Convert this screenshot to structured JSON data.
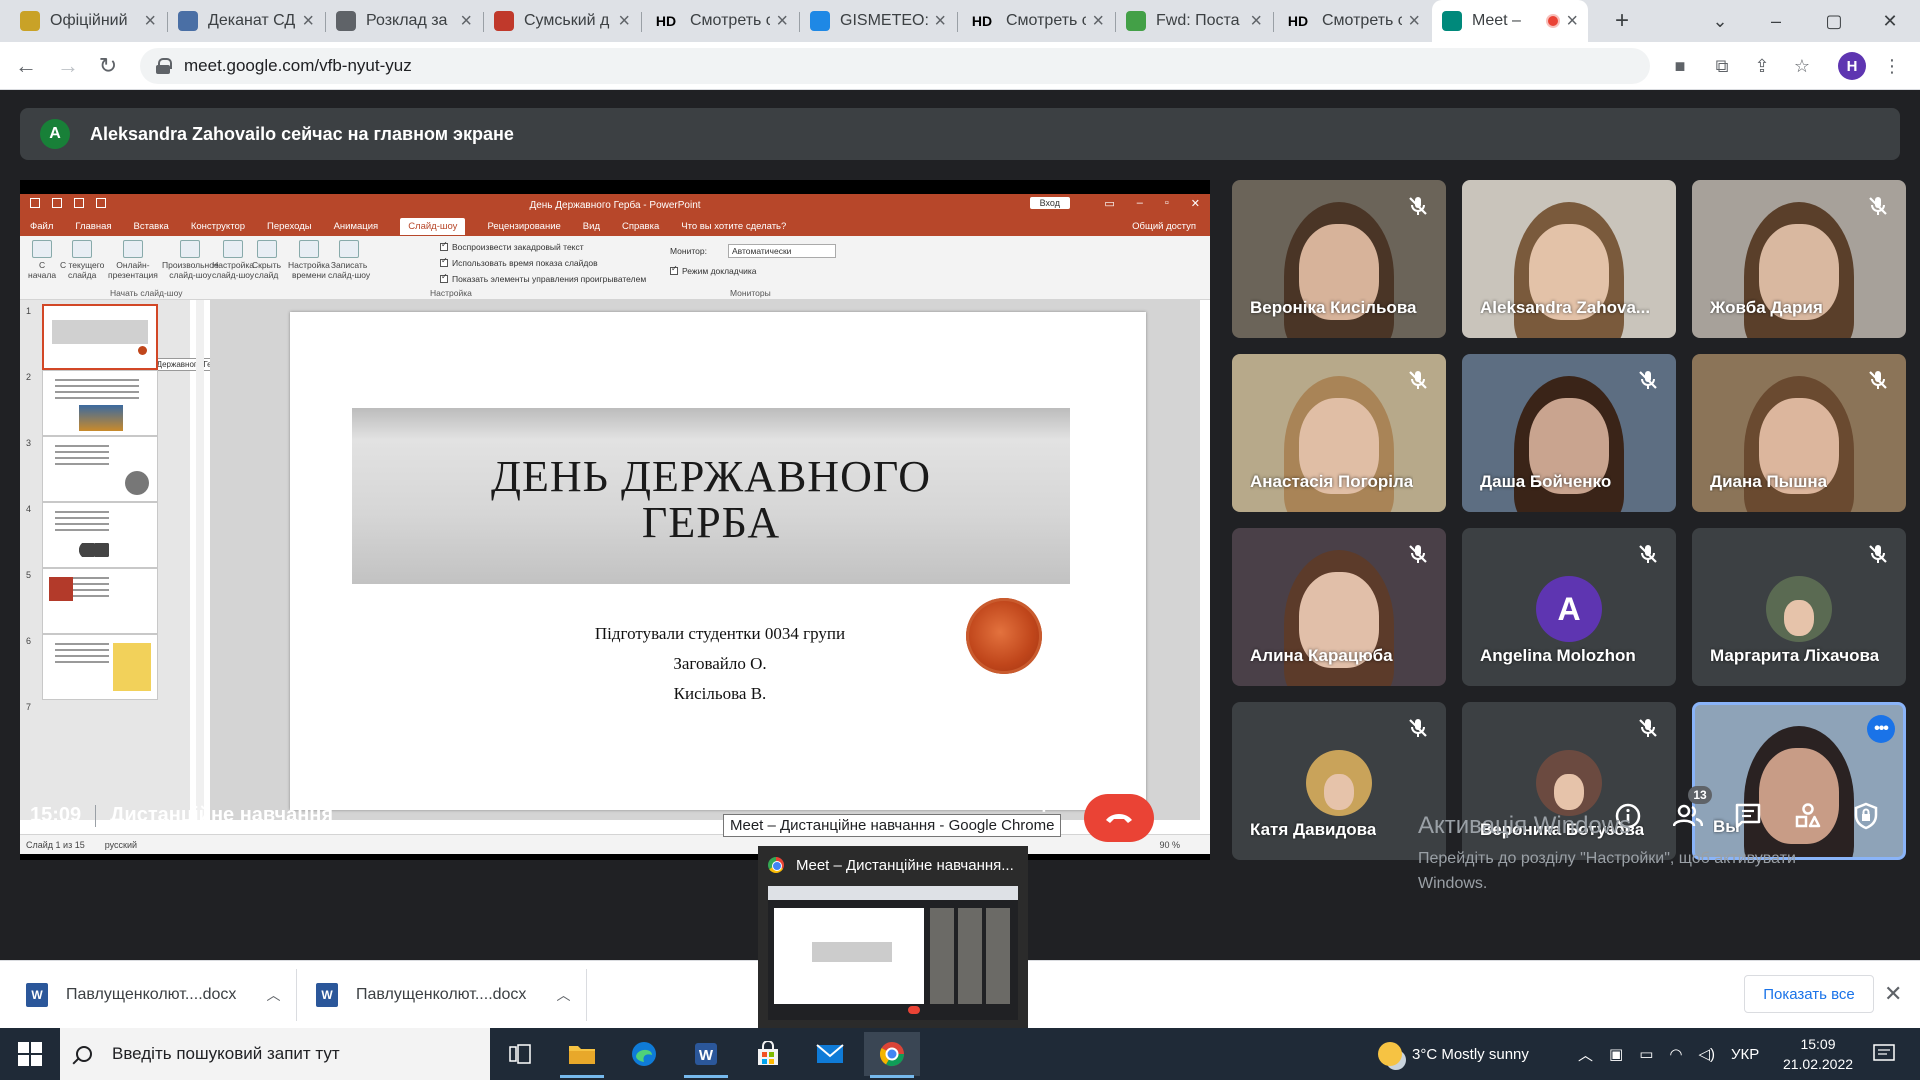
{
  "browser": {
    "tabs": [
      {
        "label": "Офіційний",
        "icon": "crest-icon",
        "color": "#c9a227"
      },
      {
        "label": "Деканат СД",
        "icon": "tool-icon",
        "color": "#4a6fa5"
      },
      {
        "label": "Розклад за",
        "icon": "globe-icon",
        "color": "#5f6368"
      },
      {
        "label": "Сумський д",
        "icon": "book-icon",
        "color": "#c0392b"
      },
      {
        "label": "Смотреть с",
        "icon": "hd-icon",
        "color": "#000000"
      },
      {
        "label": "GISMETEO:",
        "icon": "drop-icon",
        "color": "#1e88e5"
      },
      {
        "label": "Смотреть с",
        "icon": "hd-icon",
        "color": "#000000"
      },
      {
        "label": "Fwd: Поста",
        "icon": "mail-icon",
        "color": "#43a047"
      },
      {
        "label": "Смотреть с",
        "icon": "hd-icon",
        "color": "#000000"
      },
      {
        "label": "Meet –",
        "icon": "meet-icon",
        "color": "#00897b",
        "active": true
      }
    ],
    "hd_text": "HD",
    "url": "meet.google.com/vfb-nyut-yuz",
    "profile_initial": "H",
    "profile_color": "#5e35b1"
  },
  "meet": {
    "presenter_initial": "A",
    "presenting_text": "Aleksandra Zahovailo сейчас на главном экране",
    "time": "15:09",
    "meeting_name": "Дистанційне навчання",
    "participants_count": "13",
    "tooltip": "Meet – Дистанційне навчання - Google Chrome",
    "preview_title": "Meet – Дистанційне навчання...",
    "participants": [
      {
        "name": "Вероніка Кисільова",
        "type": "video",
        "bg": "#6b6459",
        "skin": "#d7b39a",
        "hair": "#4a3526",
        "muted": true
      },
      {
        "name": "Aleksandra Zahova...",
        "type": "video",
        "bg": "#c9c4bb",
        "skin": "#e3c2a8",
        "hair": "#7a5a3c",
        "muted": false
      },
      {
        "name": "Жовба Дария",
        "type": "video",
        "bg": "#a7a19a",
        "skin": "#d9b8a0",
        "hair": "#5a3f2a",
        "muted": true
      },
      {
        "name": "Анастасія Погоріла",
        "type": "video",
        "bg": "#b7a98a",
        "skin": "#e0bea5",
        "hair": "#a98457",
        "muted": true
      },
      {
        "name": "Даша Бойченко",
        "type": "video",
        "bg": "#5d6e82",
        "skin": "#c9a48f",
        "hair": "#3a2418",
        "muted": true
      },
      {
        "name": "Диана Пышна",
        "type": "video",
        "bg": "#8b7458",
        "skin": "#dcb69d",
        "hair": "#6a4a30",
        "muted": true
      },
      {
        "name": "Алина Карацюба",
        "type": "video",
        "bg": "#4a4048",
        "skin": "#e1bfa9",
        "hair": "#5c3b2a",
        "muted": true
      },
      {
        "name": "Angelina Molozhon",
        "type": "initial",
        "initial": "A",
        "color": "#5e35b1",
        "muted": true
      },
      {
        "name": "Маргарита Ліхачова",
        "type": "photo",
        "color": "#5a6a52",
        "muted": true
      },
      {
        "name": "Катя Давидова",
        "type": "photo",
        "color": "#c9a35a",
        "muted": true
      },
      {
        "name": "Вероника Ботузова",
        "type": "photo",
        "color": "#6b4a40",
        "muted": true
      },
      {
        "name": "Вы",
        "type": "video",
        "bg": "#8ea3b8",
        "skin": "#c89c86",
        "hair": "#2a2222",
        "muted": false,
        "self": true
      }
    ],
    "activation": {
      "title": "Активація Windows",
      "subtitle": "Перейдіть до розділу \"Настройки\", щоб активувати Windows."
    }
  },
  "ppt": {
    "window_title": "День Державного Герба - PowerPoint",
    "login": "Вход",
    "share": "Общий доступ",
    "menu": [
      "Файл",
      "Главная",
      "Вставка",
      "Конструктор",
      "Переходы",
      "Анимация",
      "Слайд-шоу",
      "Рецензирование",
      "Вид",
      "Справка",
      "Что вы хотите сделать?"
    ],
    "active_menu_index": 6,
    "ribbon_buttons": [
      {
        "l1": "С",
        "l2": "начала"
      },
      {
        "l1": "С текущего",
        "l2": "слайда"
      },
      {
        "l1": "Онлайн-",
        "l2": "презентация"
      },
      {
        "l1": "Произвольное",
        "l2": "слайд-шоу"
      },
      {
        "l1": "Настройка",
        "l2": "слайд-шоу"
      },
      {
        "l1": "Скрыть",
        "l2": "слайд"
      },
      {
        "l1": "Настройка",
        "l2": "времени"
      },
      {
        "l1": "Записать",
        "l2": "слайд-шоу"
      }
    ],
    "group_start": "Начать слайд-шоу",
    "group_setup": "Настройка",
    "group_monitors": "Мониторы",
    "checkboxes": [
      "Воспроизвести закадровый текст",
      "Использовать время показа слайдов",
      "Показать элементы управления проигрывателем"
    ],
    "monitor_label": "Монитор:",
    "monitor_value": "Автоматически",
    "presenter_mode": "Режим докладчика",
    "thumb_tooltip": "День Державного Герба",
    "slide_numbers": [
      "1",
      "2",
      "3",
      "4",
      "5",
      "6",
      "7"
    ],
    "slide": {
      "title_line1": "ДЕНЬ ДЕРЖАВНОГО",
      "title_line2": "ГЕРБА",
      "line1": "Підготували студентки 0034 групи",
      "line2": "Заговайло О.",
      "line3": "Кисільова В."
    },
    "status_slide": "Слайд 1 из 15",
    "status_lang": "русский",
    "status_zoom": "90 %"
  },
  "downloads": {
    "items": [
      "Павлущенколют....docx",
      "Павлущенколют....docx"
    ],
    "show_all": "Показать все"
  },
  "taskbar": {
    "search_placeholder": "Введіть пошуковий запит тут",
    "weather": "3°C  Mostly sunny",
    "language": "УКР",
    "time": "15:09",
    "date": "21.02.2022"
  }
}
